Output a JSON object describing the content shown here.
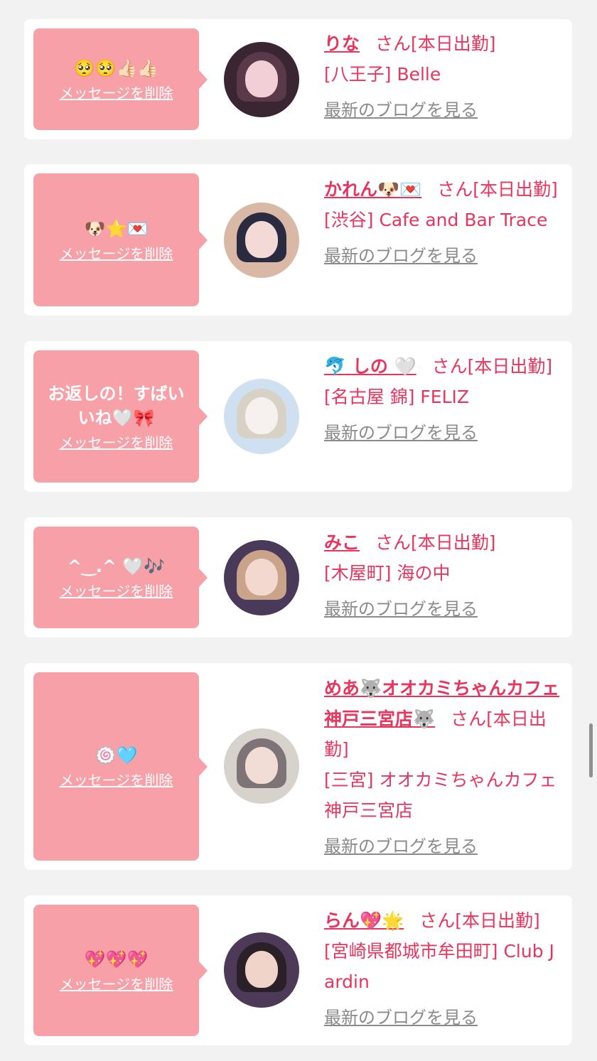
{
  "items": [
    {
      "message": "🥺🥺👍🏻👍🏻",
      "delete_label": "メッセージを削除",
      "name": "りな",
      "suffix": "さん[本日出勤]",
      "location": "[八王子] Belle",
      "blog_label": "最新のブログを見る",
      "colors": {
        "bg": "#3a2632",
        "hair": "#5a3a48",
        "face": "#f2cfd6"
      }
    },
    {
      "message": "🐶⭐💌",
      "delete_label": "メッセージを削除",
      "name": "かれん🐶💌",
      "suffix": "さん[本日出勤]",
      "location": "[渋谷] Cafe and Bar Trace",
      "blog_label": "最新のブログを見る",
      "colors": {
        "bg": "#d9b8a6",
        "hair": "#2a2a40",
        "face": "#f4dad6"
      }
    },
    {
      "message": "お返しの！すばいいね🤍🎀",
      "delete_label": "メッセージを削除",
      "name": "🐬 しの 🤍",
      "suffix": "さん[本日出勤]",
      "location": "[名古屋 錦] FELIZ",
      "blog_label": "最新のブログを見る",
      "colors": {
        "bg": "#cfe0f0",
        "hair": "#d8d2c6",
        "face": "#f6f0ee"
      }
    },
    {
      "message": "^‿.^ 🤍🎶",
      "delete_label": "メッセージを削除",
      "name": "みこ",
      "suffix": "さん[本日出勤]",
      "location": "[木屋町] 海の中",
      "blog_label": "最新のブログを見る",
      "colors": {
        "bg": "#4a3a5a",
        "hair": "#c9a48a",
        "face": "#f3d8cf"
      }
    },
    {
      "message": "🍥🩵",
      "delete_label": "メッセージを削除",
      "name": "めあ🐺オオカミちゃんカフェ神戸三宮店🐺",
      "suffix": "さん[本日出勤]",
      "location": "[三宮] オオカミちゃんカフェ神戸三宮店",
      "blog_label": "最新のブログを見る",
      "colors": {
        "bg": "#d8d2cc",
        "hair": "#7e7478",
        "face": "#f2dcd6"
      }
    },
    {
      "message": "💖💖💖",
      "delete_label": "メッセージを削除",
      "name": "らん💖🌟",
      "suffix": "さん[本日出勤]",
      "location": "[宮崎県都城市牟田町] Club Jardin",
      "blog_label": "最新のブログを見る",
      "colors": {
        "bg": "#4c3a58",
        "hair": "#2a2028",
        "face": "#f0d4ca"
      }
    }
  ]
}
